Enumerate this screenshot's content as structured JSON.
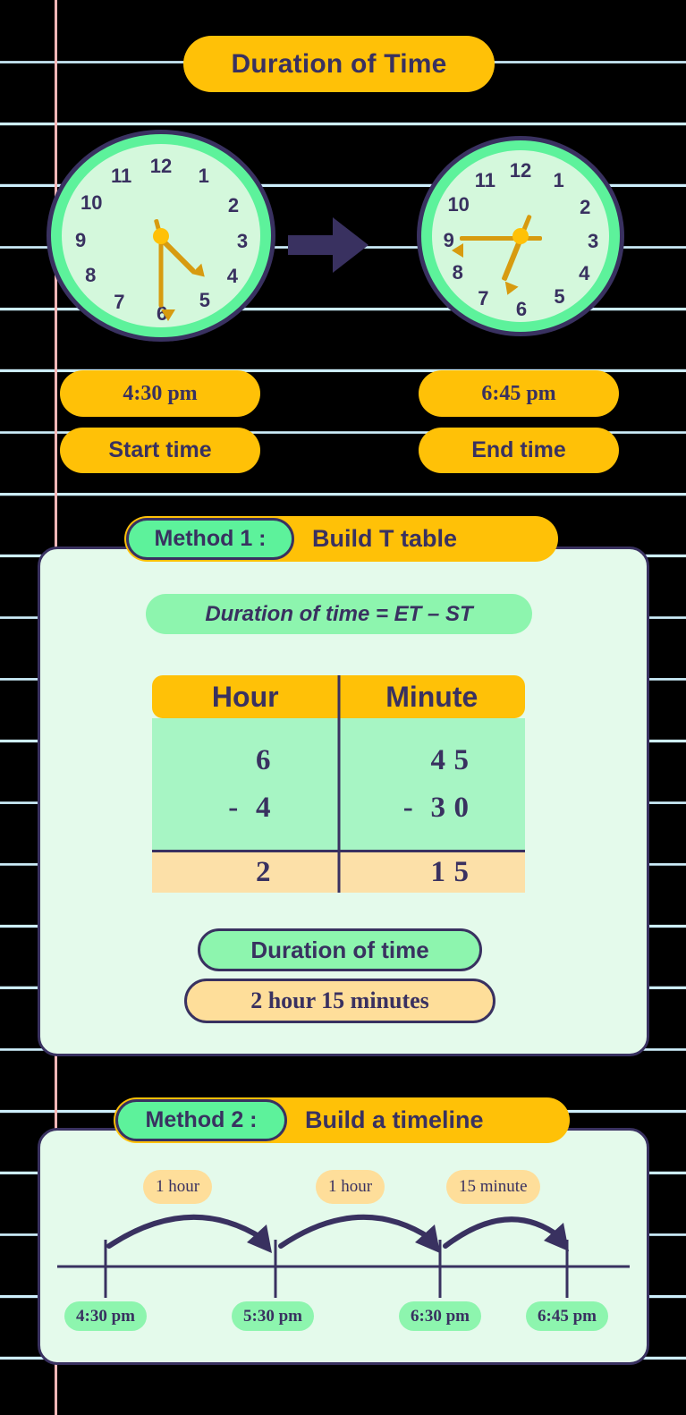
{
  "title": "Duration of Time",
  "colors": {
    "amber": "#FFC107",
    "green": "#5DF29B",
    "mint_light": "#D4F8DC",
    "peach": "#FEDE9A",
    "navy": "#393160",
    "card_bg": "#E4FAEB",
    "hand": "#D79B10",
    "paper_rule": "#CDEEFB",
    "paper_margin": "#F7B7B7"
  },
  "clocks": {
    "numerals": [
      "12",
      "1",
      "2",
      "3",
      "4",
      "5",
      "6",
      "7",
      "8",
      "9",
      "10",
      "11"
    ],
    "start": {
      "name": "start-clock",
      "time": "4:30 pm",
      "hour_hand_deg": 135,
      "minute_hand_deg": 180
    },
    "end": {
      "name": "end-clock",
      "time": "6:45 pm",
      "hour_hand_deg": 202,
      "minute_hand_deg": 270
    },
    "transition_icon": "right-arrow-icon"
  },
  "times": {
    "start_time": "4:30 pm",
    "start_label": "Start time",
    "end_time": "6:45 pm",
    "end_label": "End time"
  },
  "method1": {
    "chip": "Method 1 :",
    "title": "Build T table",
    "formula": "Duration of time = ET – ST",
    "table": {
      "headers": [
        "Hour",
        "Minute"
      ],
      "minuend": {
        "hour": [
          "6"
        ],
        "minute": [
          "4",
          "5"
        ]
      },
      "subtrahend_sign": "-",
      "subtrahend": {
        "hour": [
          "4"
        ],
        "minute": [
          "3",
          "0"
        ]
      },
      "result": {
        "hour": [
          "2"
        ],
        "minute": [
          "1",
          "5"
        ]
      }
    },
    "result_label": "Duration of time",
    "result_value": "2 hour 15 minutes"
  },
  "method2": {
    "chip": "Method 2 :",
    "title": "Build a timeline",
    "steps": [
      {
        "label": "1 hour"
      },
      {
        "label": "1 hour"
      },
      {
        "label": "15 minute"
      }
    ],
    "ticks": [
      {
        "label": "4:30 pm"
      },
      {
        "label": "5:30 pm"
      },
      {
        "label": "6:30 pm"
      },
      {
        "label": "6:45 pm"
      }
    ]
  }
}
